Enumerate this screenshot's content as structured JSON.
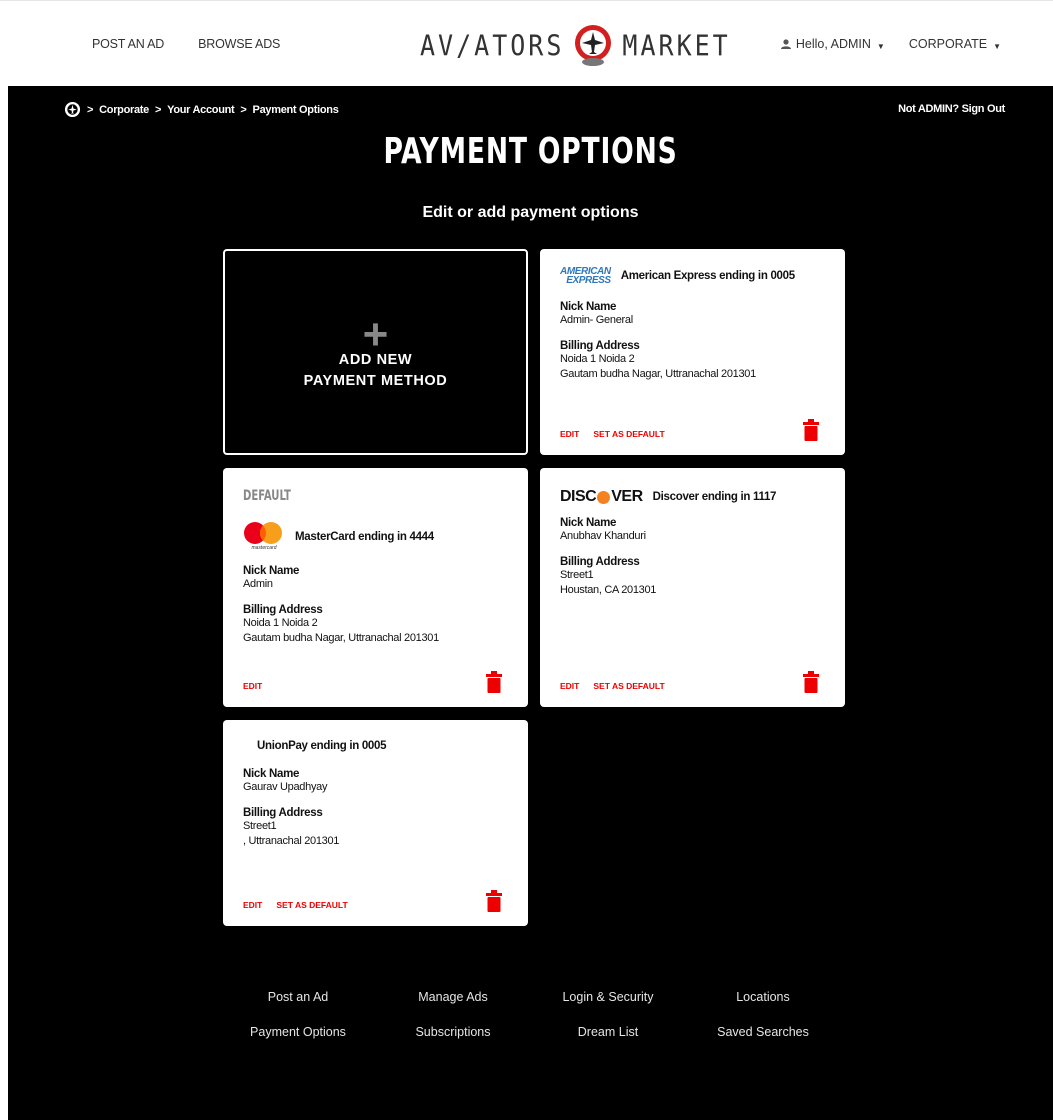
{
  "header": {
    "post_ad": "POST AN AD",
    "browse_ads": "BROWSE ADS",
    "logo_left": "AV/ATORS",
    "logo_right": "MARKET",
    "hello": "Hello, ADMIN",
    "corporate": "CORPORATE"
  },
  "breadcrumb": {
    "items": [
      "Corporate",
      "Your Account",
      "Payment Options"
    ],
    "separator": ">"
  },
  "signout": "Not ADMIN? Sign Out",
  "page": {
    "title": "PAYMENT OPTIONS",
    "subtitle": "Edit or add payment options"
  },
  "add_card": {
    "line1": "ADD NEW",
    "line2": "PAYMENT METHOD"
  },
  "cards": [
    {
      "brand": "American Express",
      "brand_logo_text": [
        "AMERICAN",
        "EXPRESS"
      ],
      "title": "American Express ending in 0005",
      "nick_label": "Nick Name",
      "nick": "Admin- General",
      "billing_label": "Billing Address",
      "address1": "Noida 1 Noida 2",
      "address2": "Gautam budha Nagar, Uttranachal 201301",
      "edit": "EDIT",
      "set_default": "SET AS DEFAULT"
    },
    {
      "default_badge": "DEFAULT",
      "brand": "MasterCard",
      "brand_logo_text": "mastercard",
      "title": "MasterCard ending in 4444",
      "nick_label": "Nick Name",
      "nick": "Admin",
      "billing_label": "Billing Address",
      "address1": "Noida 1 Noida 2",
      "address2": "Gautam budha Nagar, Uttranachal 201301",
      "edit": "EDIT"
    },
    {
      "brand": "Discover",
      "brand_logo_text": [
        "DISC",
        "VER"
      ],
      "title": "Discover ending in 1117",
      "nick_label": "Nick Name",
      "nick": "Anubhav Khanduri",
      "billing_label": "Billing Address",
      "address1": "Street1",
      "address2": "Houstan, CA 201301",
      "edit": "EDIT",
      "set_default": "SET AS DEFAULT"
    },
    {
      "brand": "UnionPay",
      "title": "UnionPay ending in 0005",
      "nick_label": "Nick Name",
      "nick": "Gaurav Upadhyay",
      "billing_label": "Billing Address",
      "address1": "Street1",
      "address2": ", Uttranachal 201301",
      "edit": "EDIT",
      "set_default": "SET AS DEFAULT"
    }
  ],
  "footer": {
    "row1": [
      "Post an Ad",
      "Manage Ads",
      "Login & Security",
      "Locations"
    ],
    "row2": [
      "Payment Options",
      "Subscriptions",
      "Dream List",
      "Saved Searches"
    ]
  },
  "colors": {
    "accent_red": "#e00000",
    "amex_blue": "#2e77bc",
    "discover_orange": "#f58220",
    "mc_red": "#eb001b",
    "mc_yellow": "#f79e1b"
  }
}
